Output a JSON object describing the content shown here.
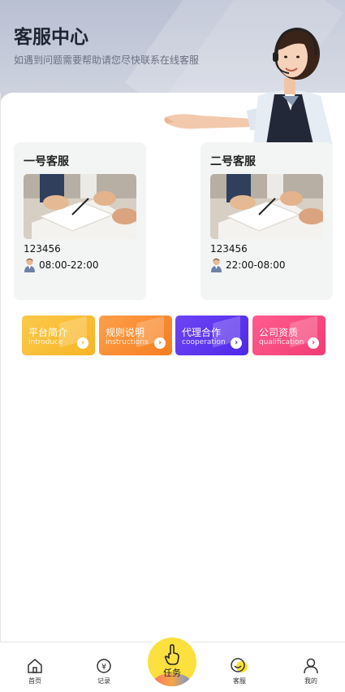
{
  "header": {
    "title": "客服中心",
    "subtitle": "如遇到问题需要帮助请您尽快联系在线客服"
  },
  "agents": [
    {
      "title": "一号客服",
      "id": "123456",
      "hours": "08:00-22:00"
    },
    {
      "title": "二号客服",
      "id": "123456",
      "hours": "22:00-08:00"
    }
  ],
  "features": [
    {
      "title": "平台简介",
      "subtitle": "introduce",
      "color": "#f8b526"
    },
    {
      "title": "规则说明",
      "subtitle": "instructions",
      "color": "#f77d1f"
    },
    {
      "title": "代理合作",
      "subtitle": "cooperation",
      "color": "#4e29e8"
    },
    {
      "title": "公司资质",
      "subtitle": "qualification",
      "color": "#f23c73"
    }
  ],
  "tabbar": {
    "home": "首页",
    "records": "记录",
    "task": "任务",
    "service": "客服",
    "mine": "我的"
  }
}
